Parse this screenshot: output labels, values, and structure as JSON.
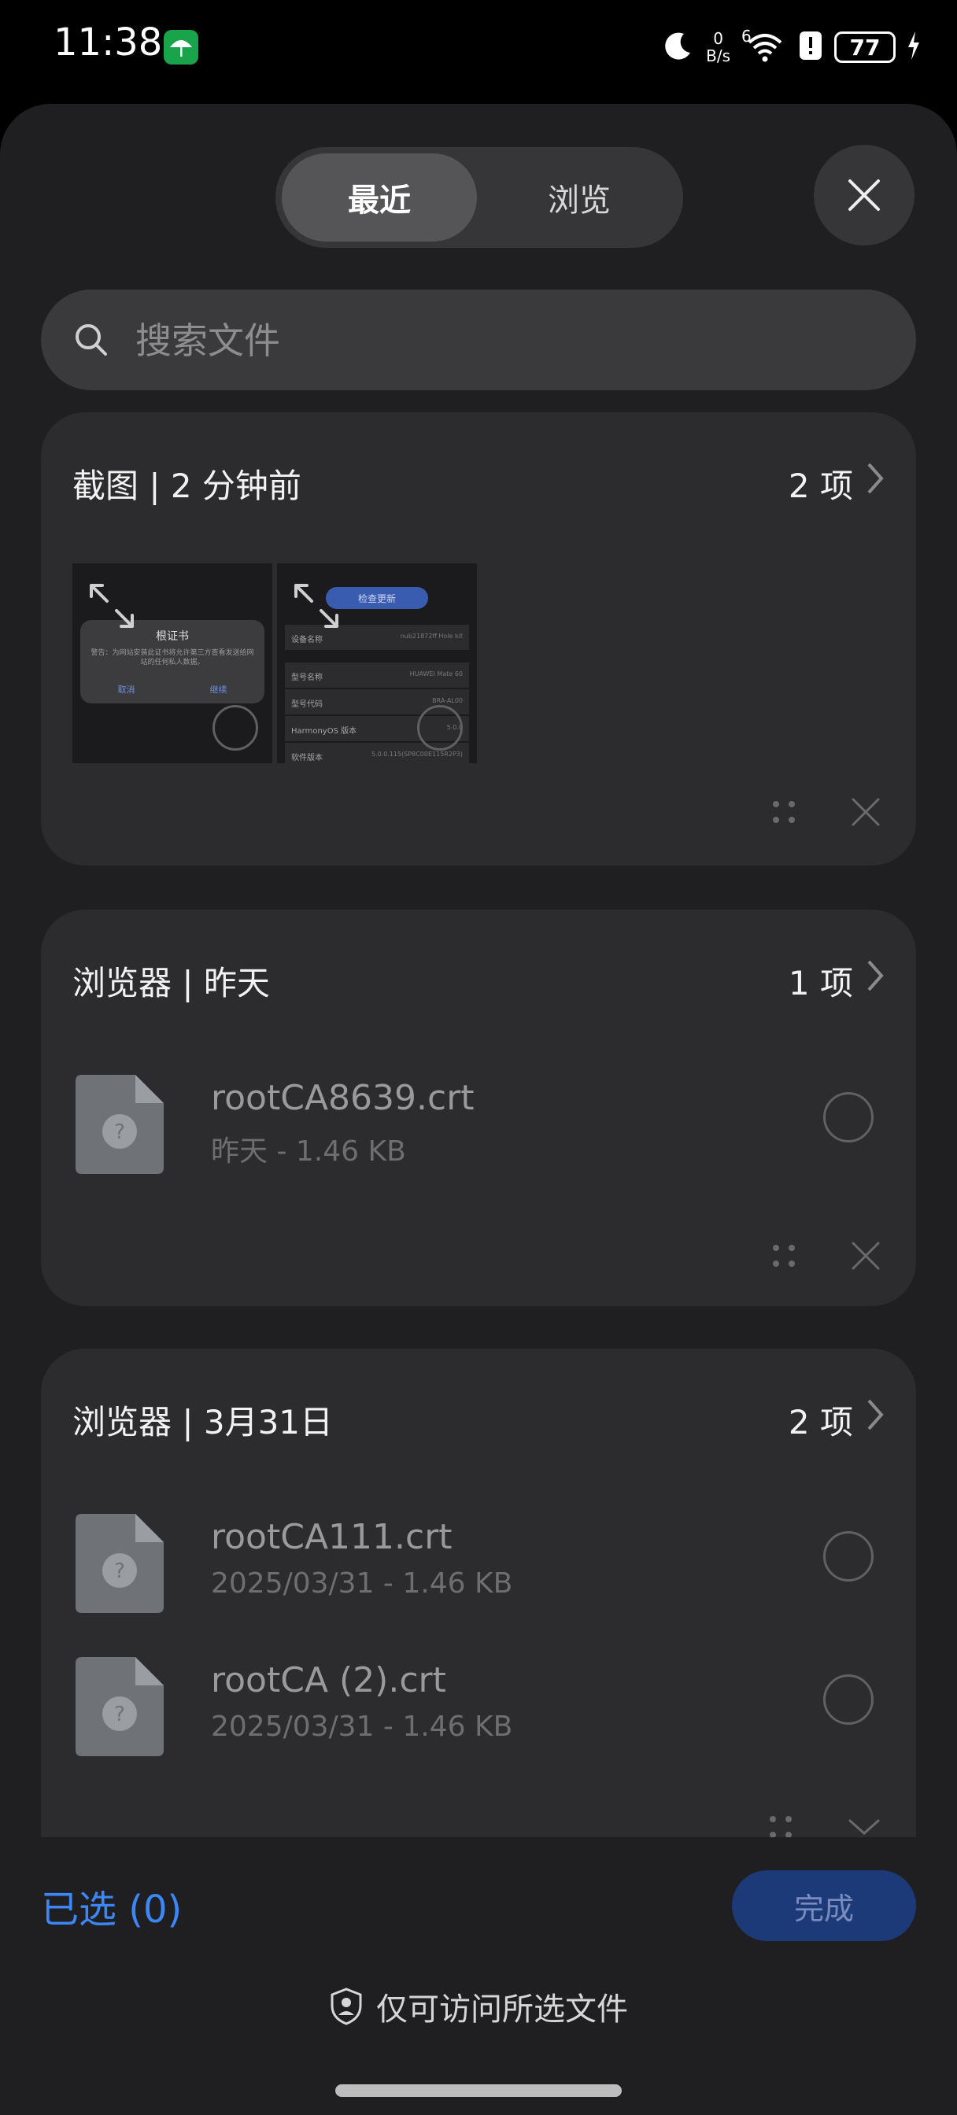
{
  "status_bar": {
    "time": "11:38",
    "net_speed_value": "0",
    "net_speed_unit": "B/s",
    "signal_label": "6",
    "battery": "77",
    "app_icon_color": "#19a34a"
  },
  "tabs": {
    "recent": "最近",
    "browse": "浏览",
    "active": "recent"
  },
  "search": {
    "placeholder": "搜索文件"
  },
  "groups": [
    {
      "title": "截图 | 2 分钟前",
      "count": "2 项",
      "thumbnails": [
        {
          "dialog_title": "根证书",
          "dialog_body": "警告：为网站安装此证书将允许第三方查看发送给网站的任何私人数据。",
          "cancel": "取消",
          "confirm": "继续"
        },
        {
          "button": "检查更新",
          "rows": [
            {
              "key": "设备名称",
              "value": "nub21872ff Hole kit"
            },
            {
              "key": "型号名称",
              "value": "HUAWEI Mate 60"
            },
            {
              "key": "型号代码",
              "value": "BRA-AL00"
            },
            {
              "key": "HarmonyOS 版本",
              "value": "5.0.0"
            },
            {
              "key": "软件版本",
              "value": "5.0.0.115(SP8C00E115R2P3)"
            }
          ]
        }
      ]
    },
    {
      "title": "浏览器 | 昨天",
      "count": "1 项",
      "files": [
        {
          "name": "rootCA8639.crt",
          "meta": "昨天 - 1.46 KB"
        }
      ]
    },
    {
      "title": "浏览器 | 3月31日",
      "count": "2 项",
      "files": [
        {
          "name": "rootCA111.crt",
          "meta": "2025/03/31 - 1.46 KB"
        },
        {
          "name": "rootCA (2).crt",
          "meta": "2025/03/31 - 1.46 KB"
        }
      ]
    }
  ],
  "footer": {
    "selected": "已选 (0)",
    "done": "完成",
    "access_note": "仅可访问所选文件",
    "accent_color": "#3d86f5"
  }
}
